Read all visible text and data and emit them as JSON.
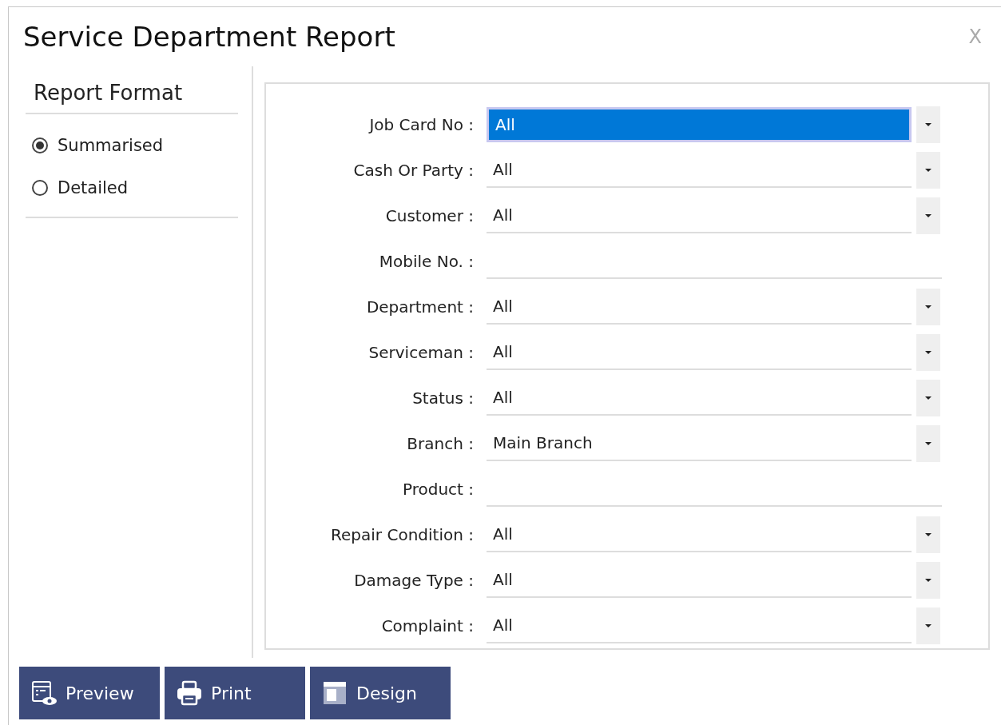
{
  "window": {
    "title": "Service Department Report",
    "close": "X"
  },
  "report_format": {
    "title": "Report Format",
    "options": [
      {
        "label": "Summarised",
        "selected": true
      },
      {
        "label": "Detailed",
        "selected": false
      }
    ]
  },
  "fields": [
    {
      "label": "Job Card No :",
      "kind": "select",
      "value": "All",
      "selected": true
    },
    {
      "label": "Cash Or Party :",
      "kind": "select",
      "value": "All",
      "selected": false
    },
    {
      "label": "Customer :",
      "kind": "select",
      "value": "All",
      "selected": false
    },
    {
      "label": "Mobile No. :",
      "kind": "text",
      "selected": false
    },
    {
      "label": "Department :",
      "kind": "select",
      "value": "All",
      "selected": false
    },
    {
      "label": "Serviceman :",
      "kind": "select",
      "value": "All",
      "selected": false
    },
    {
      "label": "Status :",
      "kind": "select",
      "value": "All",
      "selected": false
    },
    {
      "label": "Branch :",
      "kind": "select",
      "value": "Main Branch",
      "selected": false
    },
    {
      "label": "Product :",
      "kind": "text",
      "selected": false
    },
    {
      "label": "Repair Condition :",
      "kind": "select",
      "value": "All",
      "selected": false
    },
    {
      "label": "Damage Type :",
      "kind": "select",
      "value": "All",
      "selected": false
    },
    {
      "label": "Complaint :",
      "kind": "select",
      "value": "All",
      "selected": false
    }
  ],
  "buttons": [
    {
      "label": "Preview",
      "kind": "preview"
    },
    {
      "label": "Print",
      "kind": "print"
    },
    {
      "label": "Design",
      "kind": "design"
    }
  ]
}
